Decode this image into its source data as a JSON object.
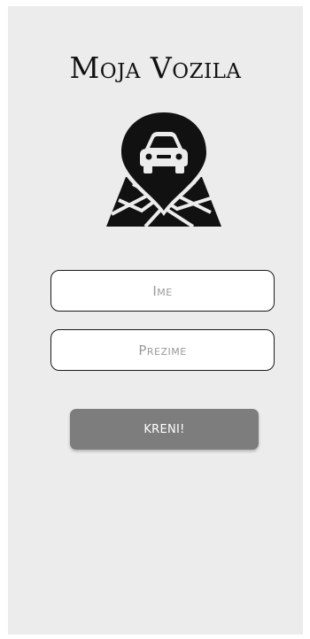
{
  "app": {
    "title": "Moja Vozila",
    "logo_icon": "car-location-map-icon"
  },
  "form": {
    "first_name": {
      "placeholder": "Ime",
      "value": ""
    },
    "last_name": {
      "placeholder": "Prezime",
      "value": ""
    },
    "submit_label": "KRENI!"
  },
  "colors": {
    "background": "#ececec",
    "button": "#7d7d7d",
    "button_text": "#ffffff",
    "field_border": "#1a1a1a"
  }
}
